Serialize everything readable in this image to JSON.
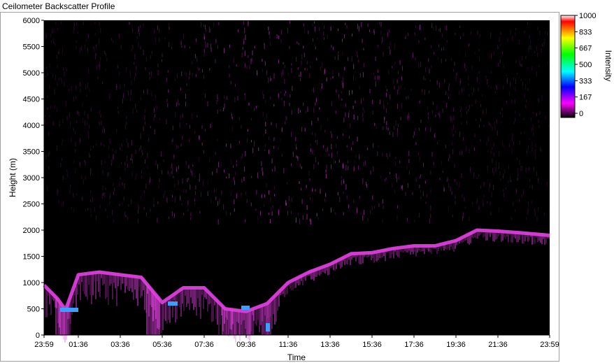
{
  "window": {
    "title": "Ceilometer Backscatter Profile"
  },
  "chart_data": {
    "type": "heatmap",
    "title": "Ceilometer Backscatter Profile",
    "xlabel": "Time",
    "ylabel": "Height (m)",
    "x_tick_labels": [
      "23:59",
      "01:36",
      "03:36",
      "05:36",
      "07:36",
      "09:36",
      "11:36",
      "13:36",
      "15:36",
      "17:36",
      "19:36",
      "21:36",
      "23:59"
    ],
    "y_ticks": [
      0,
      500,
      1000,
      1500,
      2000,
      2500,
      3000,
      3500,
      4000,
      4500,
      5000,
      5500,
      6000
    ],
    "ylim": [
      0,
      6000
    ],
    "colorbar": {
      "label": "Intensity",
      "range": [
        0,
        1000
      ],
      "ticks": [
        0,
        167,
        333,
        500,
        667,
        833,
        1000
      ],
      "colors": [
        "#000000",
        "#ff00ff",
        "#0000ff",
        "#00ffff",
        "#00ff00",
        "#ffff00",
        "#ff0000",
        "#ffffff"
      ]
    },
    "background_color": "#000000",
    "layer_color": "#e040e0",
    "strong_return_color": "#3aa0ff",
    "cloud_layer_height_m": [
      {
        "time": "23:59",
        "height": 950
      },
      {
        "time": "00:36",
        "height": 700
      },
      {
        "time": "01:00",
        "height": 480
      },
      {
        "time": "01:36",
        "height": 1150
      },
      {
        "time": "02:36",
        "height": 1200
      },
      {
        "time": "03:36",
        "height": 1150
      },
      {
        "time": "04:36",
        "height": 1100
      },
      {
        "time": "05:36",
        "height": 620
      },
      {
        "time": "06:36",
        "height": 900
      },
      {
        "time": "07:36",
        "height": 900
      },
      {
        "time": "08:36",
        "height": 500
      },
      {
        "time": "09:36",
        "height": 450
      },
      {
        "time": "10:36",
        "height": 600
      },
      {
        "time": "11:36",
        "height": 1000
      },
      {
        "time": "12:36",
        "height": 1200
      },
      {
        "time": "13:36",
        "height": 1350
      },
      {
        "time": "14:36",
        "height": 1550
      },
      {
        "time": "15:36",
        "height": 1570
      },
      {
        "time": "16:36",
        "height": 1650
      },
      {
        "time": "17:36",
        "height": 1700
      },
      {
        "time": "18:36",
        "height": 1700
      },
      {
        "time": "19:36",
        "height": 1800
      },
      {
        "time": "20:36",
        "height": 2000
      },
      {
        "time": "21:36",
        "height": 1980
      },
      {
        "time": "22:36",
        "height": 1950
      },
      {
        "time": "23:59",
        "height": 1900
      }
    ]
  }
}
